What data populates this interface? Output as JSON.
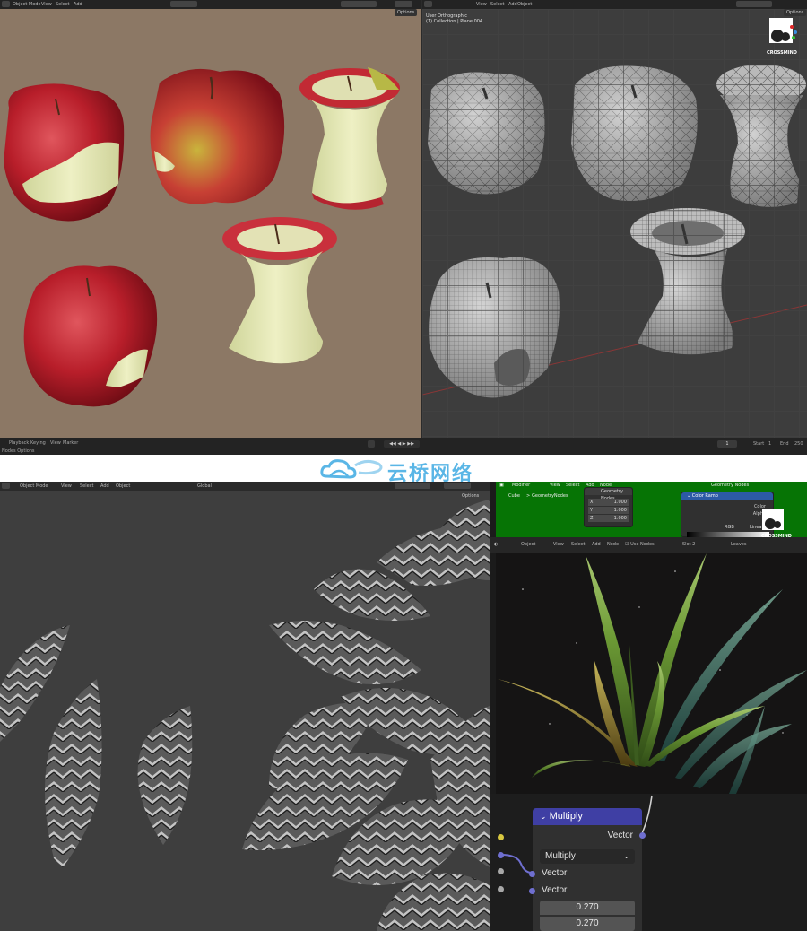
{
  "top": {
    "header_left": [
      "Object Mode",
      "View",
      "Select",
      "Add",
      "Object"
    ],
    "header_right": [
      "View",
      "Select",
      "Add",
      "Object"
    ],
    "options_label": "Options",
    "right_viewport_title": "User Orthographic",
    "right_viewport_subtitle": "(1) Collection | Plane.004",
    "timeline": {
      "menus": [
        "Playback",
        "Keying",
        "View",
        "Marker"
      ],
      "current_frame": "1",
      "start_label": "Start",
      "start_value": "1",
      "end_label": "End",
      "end_value": "250"
    },
    "status_left": "Nodes  Options"
  },
  "watermark": {
    "text": "云桥网络",
    "color": "#5ab6e6"
  },
  "brand_logo_text": "CROSSMIND",
  "bottom": {
    "header_left": [
      "Object Mode",
      "View",
      "Select",
      "Add",
      "Object"
    ],
    "header_center": "Global",
    "options_label": "Options",
    "green_editor": {
      "header": [
        "Modifier",
        "View",
        "Select",
        "Add",
        "Node"
      ],
      "node_tree_name": "Geometry Nodes",
      "breadcrumb": [
        "Cube",
        "GeometryNodes"
      ],
      "scale_node": {
        "x": "1.000",
        "y": "1.000",
        "z": "1.000"
      },
      "color_ramp": {
        "title": "Color Ramp",
        "color_label": "Color",
        "alpha_label": "Alpha",
        "mode": "RGB",
        "interp": "Linear"
      }
    },
    "shader_bar": {
      "editor_type": "Object",
      "menus": [
        "View",
        "Select",
        "Add",
        "Node"
      ],
      "use_nodes": "Use Nodes",
      "slot": "Slot 2",
      "material": "Leaves"
    },
    "multiply_node": {
      "title": "Multiply",
      "output_label": "Vector",
      "operation": "Multiply",
      "input1_label": "Vector",
      "input2_label": "Vector",
      "value1": "0.270",
      "value2": "0.270"
    }
  }
}
